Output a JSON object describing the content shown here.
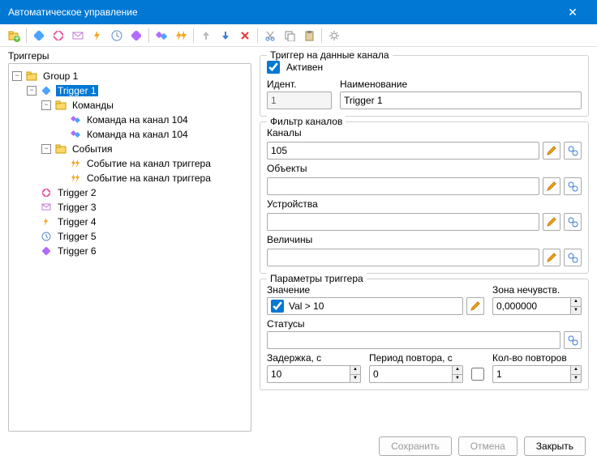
{
  "titlebar": {
    "title": "Автоматическое управление"
  },
  "left": {
    "label": "Триггеры"
  },
  "tree": {
    "group": "Group 1",
    "trigger1": "Trigger 1",
    "commands": "Команды",
    "cmd104a": "Команда на канал 104",
    "cmd104b": "Команда на канал 104",
    "events": "События",
    "evtTrigA": "Событие на канал триггера",
    "evtTrigB": "Событие на канал триггера",
    "trigger2": "Trigger 2",
    "trigger3": "Trigger 3",
    "trigger4": "Trigger 4",
    "trigger5": "Trigger 5",
    "trigger6": "Trigger 6"
  },
  "g1": {
    "title": "Триггер на данные канала",
    "active": "Активен",
    "identLbl": "Идент.",
    "identVal": "1",
    "nameLbl": "Наименование",
    "nameVal": "Trigger 1"
  },
  "g2": {
    "title": "Фильтр каналов",
    "channelsLbl": "Каналы",
    "channelsVal": "105",
    "objectsLbl": "Объекты",
    "objectsVal": "",
    "devicesLbl": "Устройства",
    "devicesVal": "",
    "quantitiesLbl": "Величины",
    "quantitiesVal": ""
  },
  "g3": {
    "title": "Параметры триггера",
    "valueLbl": "Значение",
    "valueVal": "Val > 10",
    "deadbandLbl": "Зона нечувств.",
    "deadbandVal": "0,000000",
    "statusesLbl": "Статусы",
    "statusesVal": "",
    "delayLbl": "Задержка, с",
    "delayVal": "10",
    "periodLbl": "Период повтора, с",
    "periodVal": "0",
    "repeatsLbl": "Кол-во повторов",
    "repeatsVal": "1"
  },
  "footer": {
    "save": "Сохранить",
    "cancel": "Отмена",
    "close": "Закрыть"
  }
}
